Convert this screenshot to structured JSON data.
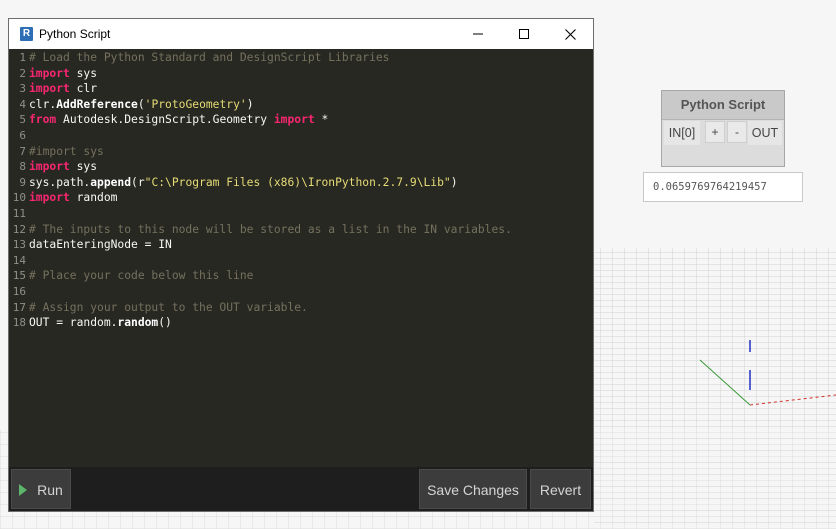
{
  "window": {
    "title": "Python Script",
    "controls": [
      "minimize",
      "maximize",
      "close"
    ]
  },
  "editor": {
    "line_numbers": [
      "1",
      "2",
      "3",
      "4",
      "5",
      "6",
      "7",
      "8",
      "9",
      "10",
      "11",
      "12",
      "13",
      "14",
      "15",
      "16",
      "17",
      "18"
    ],
    "lines": [
      [
        {
          "t": "# Load the Python Standard and DesignScript Libraries",
          "c": "comment"
        }
      ],
      [
        {
          "t": "import",
          "c": "kw"
        },
        {
          "t": " sys",
          "c": "plain"
        }
      ],
      [
        {
          "t": "import",
          "c": "kw"
        },
        {
          "t": " clr",
          "c": "plain"
        }
      ],
      [
        {
          "t": "clr.",
          "c": "plain"
        },
        {
          "t": "AddReference",
          "c": "id"
        },
        {
          "t": "(",
          "c": "plain"
        },
        {
          "t": "'ProtoGeometry'",
          "c": "str"
        },
        {
          "t": ")",
          "c": "plain"
        }
      ],
      [
        {
          "t": "from",
          "c": "kw"
        },
        {
          "t": " Autodesk.DesignScript.Geometry ",
          "c": "plain"
        },
        {
          "t": "import",
          "c": "kw"
        },
        {
          "t": " *",
          "c": "plain"
        }
      ],
      [],
      [
        {
          "t": "#import sys",
          "c": "comment"
        }
      ],
      [
        {
          "t": "import",
          "c": "kw"
        },
        {
          "t": " sys",
          "c": "plain"
        }
      ],
      [
        {
          "t": "sys.path.",
          "c": "plain"
        },
        {
          "t": "append",
          "c": "id"
        },
        {
          "t": "(r",
          "c": "plain"
        },
        {
          "t": "\"C:\\Program Files (x86)\\IronPython.2.7.9\\Lib\"",
          "c": "str"
        },
        {
          "t": ")",
          "c": "plain"
        }
      ],
      [
        {
          "t": "import",
          "c": "kw"
        },
        {
          "t": " random",
          "c": "plain"
        }
      ],
      [],
      [
        {
          "t": "# The inputs to this node will be stored as a list in the IN variables.",
          "c": "comment"
        }
      ],
      [
        {
          "t": "dataEnteringNode = IN",
          "c": "plain"
        }
      ],
      [],
      [
        {
          "t": "# Place your code below this line",
          "c": "comment"
        }
      ],
      [],
      [
        {
          "t": "# Assign your output to the OUT variable.",
          "c": "comment"
        }
      ],
      [
        {
          "t": "OUT = random.",
          "c": "plain"
        },
        {
          "t": "random",
          "c": "id"
        },
        {
          "t": "()",
          "c": "plain"
        }
      ]
    ]
  },
  "buttons": {
    "run": "Run",
    "save_changes": "Save Changes",
    "revert": "Revert"
  },
  "node": {
    "title": "Python Script",
    "input_port": "IN[0]",
    "add_port": "+",
    "remove_port": "-",
    "output_port": "OUT",
    "preview_value": "0.0659769764219457"
  },
  "colors": {
    "editor_bg": "#272822",
    "comment": "#75715e",
    "keyword": "#f92672",
    "string": "#e6db74"
  }
}
